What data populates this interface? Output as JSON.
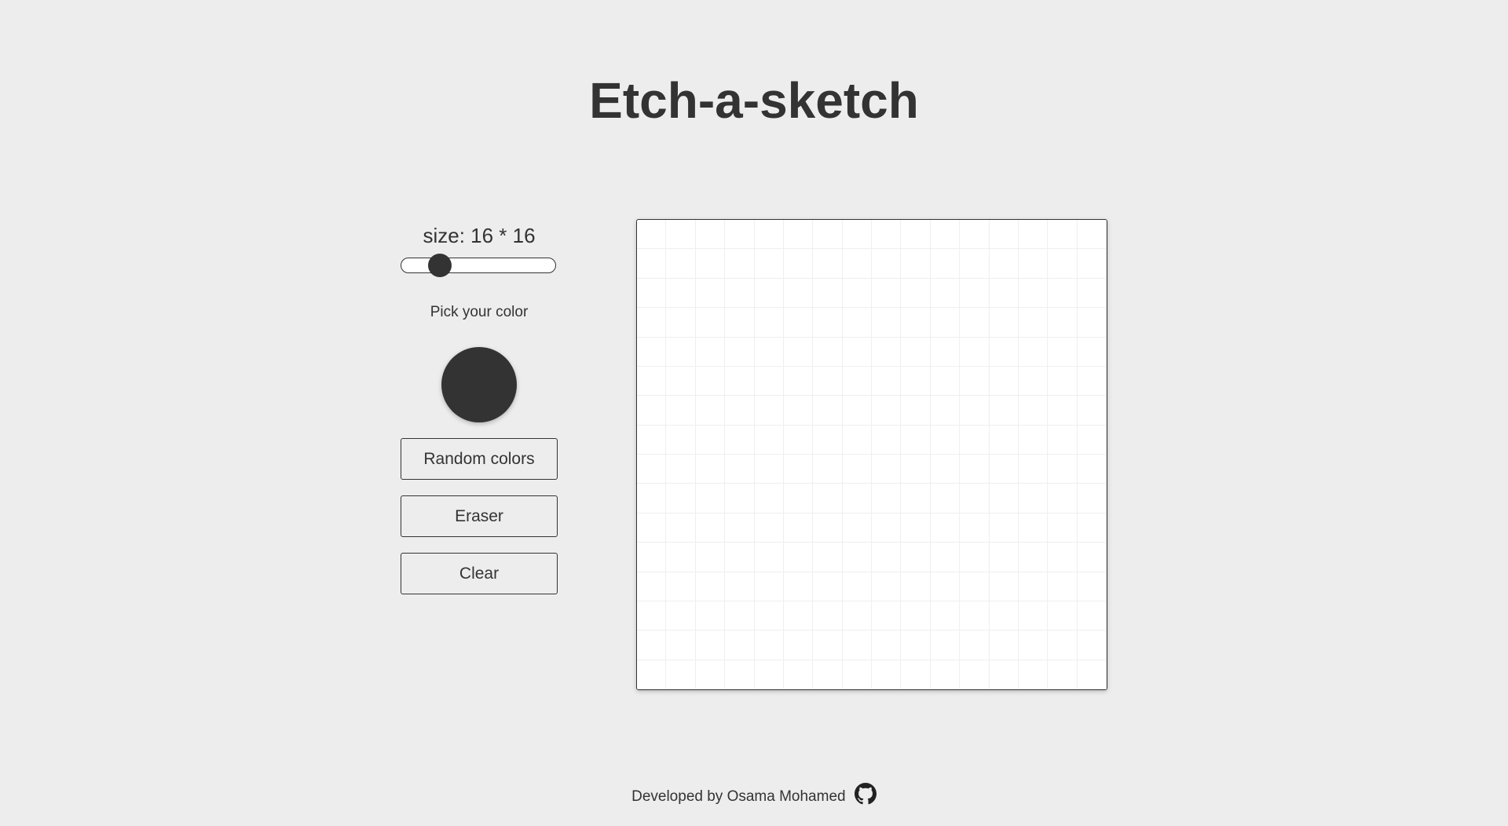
{
  "header": {
    "title": "Etch-a-sketch"
  },
  "controls": {
    "size_label": "size: 16 * 16",
    "slider": {
      "value": 16,
      "min": 1,
      "max": 100
    },
    "pick_label": "Pick your color",
    "selected_color": "#333333",
    "random_button_label": "Random colors",
    "eraser_button_label": "Eraser",
    "clear_button_label": "Clear"
  },
  "board": {
    "grid_size": 16,
    "background_color": "#ffffff",
    "line_color": "#efefef"
  },
  "footer": {
    "text": "Developed by Osama Mohamed",
    "icon": "github-icon"
  }
}
